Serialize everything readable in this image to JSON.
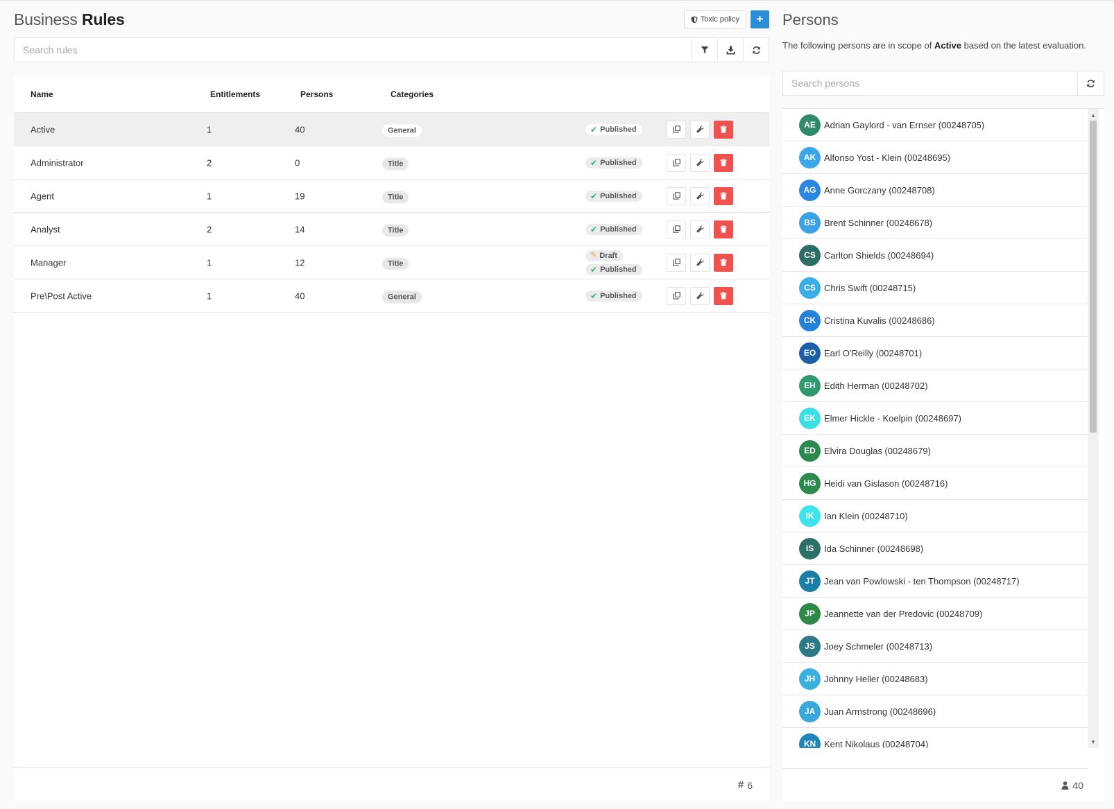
{
  "rules": {
    "title_light": "Business",
    "title_bold": "Rules",
    "toxic_policy_label": "Toxic policy",
    "add_label": "+",
    "search_placeholder": "Search rules",
    "columns": {
      "name": "Name",
      "entitlements": "Entitlements",
      "persons": "Persons",
      "categories": "Categories"
    },
    "rows": [
      {
        "name": "Active",
        "entitlements": "1",
        "persons": "40",
        "category": "General",
        "statuses": [
          "Published"
        ]
      },
      {
        "name": "Administrator",
        "entitlements": "2",
        "persons": "0",
        "category": "Title",
        "statuses": [
          "Published"
        ]
      },
      {
        "name": "Agent",
        "entitlements": "1",
        "persons": "19",
        "category": "Title",
        "statuses": [
          "Published"
        ]
      },
      {
        "name": "Analyst",
        "entitlements": "2",
        "persons": "14",
        "category": "Title",
        "statuses": [
          "Published"
        ]
      },
      {
        "name": "Manager",
        "entitlements": "1",
        "persons": "12",
        "category": "Title",
        "statuses": [
          "Draft",
          "Published"
        ]
      },
      {
        "name": "Pre\\Post Active",
        "entitlements": "1",
        "persons": "40",
        "category": "General",
        "statuses": [
          "Published"
        ]
      }
    ],
    "count": "6"
  },
  "persons": {
    "title": "Persons",
    "desc_before": "The following persons are in scope of ",
    "desc_rule": "Active",
    "desc_after": " based on the latest evaluation.",
    "search_placeholder": "Search persons",
    "count": "40",
    "items": [
      {
        "initials": "AE",
        "name": "Adrian Gaylord - van Ernser (00248705)",
        "color": "#2e8b6a"
      },
      {
        "initials": "AK",
        "name": "Alfonso Yost - Klein (00248695)",
        "color": "#3aa8e8"
      },
      {
        "initials": "AG",
        "name": "Anne Gorczany (00248708)",
        "color": "#2a86e0"
      },
      {
        "initials": "BS",
        "name": "Brent Schinner (00248678)",
        "color": "#3aa3e6"
      },
      {
        "initials": "CS",
        "name": "Carlton Shields (00248694)",
        "color": "#2c6e66"
      },
      {
        "initials": "CS",
        "name": "Chris Swift (00248715)",
        "color": "#3aade8"
      },
      {
        "initials": "CK",
        "name": "Cristina Kuvalis (00248686)",
        "color": "#2582d8"
      },
      {
        "initials": "EO",
        "name": "Earl O'Reilly (00248701)",
        "color": "#1a5fa8"
      },
      {
        "initials": "EH",
        "name": "Edith Herman (00248702)",
        "color": "#2f9a6e"
      },
      {
        "initials": "EK",
        "name": "Elmer Hickle - Koelpin (00248697)",
        "color": "#3be0e6"
      },
      {
        "initials": "ED",
        "name": "Elvira Douglas (00248679)",
        "color": "#2a8a4e"
      },
      {
        "initials": "HG",
        "name": "Heidi van Gislason (00248716)",
        "color": "#2c8a4c"
      },
      {
        "initials": "IK",
        "name": "Ian Klein (00248710)",
        "color": "#3ee4ec"
      },
      {
        "initials": "IS",
        "name": "Ida Schinner (00248698)",
        "color": "#2c7068"
      },
      {
        "initials": "JT",
        "name": "Jean van Powlowski - ten Thompson (00248717)",
        "color": "#1a7fa6"
      },
      {
        "initials": "JP",
        "name": "Jeannette van der Predovic (00248709)",
        "color": "#2b8a48"
      },
      {
        "initials": "JS",
        "name": "Joey Schmeler (00248713)",
        "color": "#2d7a86"
      },
      {
        "initials": "JH",
        "name": "Johnny Heller (00248683)",
        "color": "#3ab0e0"
      },
      {
        "initials": "JA",
        "name": "Juan Armstrong (00248696)",
        "color": "#3aa8dc"
      },
      {
        "initials": "KN",
        "name": "Kent Nikolaus (00248704)",
        "color": "#1f86b8"
      }
    ]
  },
  "colors": {
    "accent": "#2a8fd8",
    "danger": "#f0524f",
    "published_check": "#2fb36b",
    "draft_pencil": "#e0a93a"
  }
}
